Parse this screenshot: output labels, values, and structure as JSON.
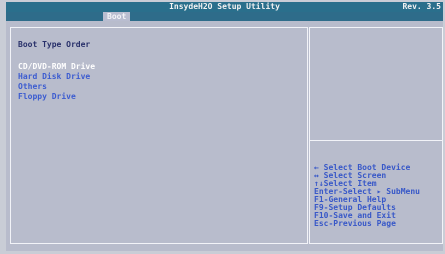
{
  "window": {
    "title": "InsydeH2O Setup Utility",
    "revision": "Rev. 3.5"
  },
  "tabs": [
    {
      "label": "Boot",
      "active": true
    }
  ],
  "boot": {
    "section_title": "Boot Type Order",
    "items": [
      {
        "label": "CD/DVD-ROM Drive",
        "selected": true
      },
      {
        "label": "Hard Disk Drive",
        "selected": false
      },
      {
        "label": "Others",
        "selected": false
      },
      {
        "label": "Floppy Drive",
        "selected": false
      }
    ]
  },
  "help": [
    "←      Select Boot Device",
    "↔      Select Screen",
    "↑↓Select Item",
    "Enter-Select ▸ SubMenu",
    "F1-General Help",
    "F9-Setup Defaults",
    "F10-Save and Exit",
    "Esc-Previous Page"
  ],
  "colors": {
    "title_bar": "#2a6f8c",
    "background": "#b8bccc",
    "item_text": "#3c5cd0",
    "selected_text": "#ffffff",
    "section_text": "#28306a"
  }
}
